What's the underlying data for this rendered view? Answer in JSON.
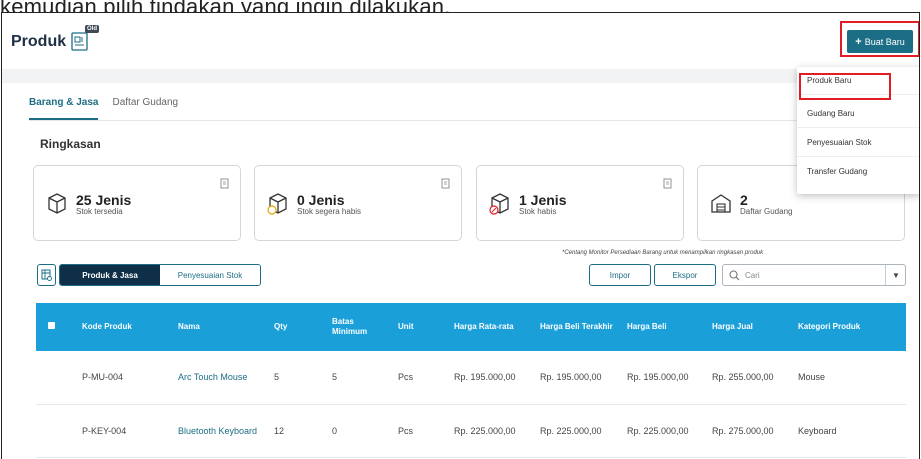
{
  "caption": "kemudian pilih tindakan yang ingin dilakukan.",
  "header": {
    "title": "Produk",
    "old_badge": "Old",
    "create_button": "Buat Baru"
  },
  "tabs": [
    {
      "label": "Barang & Jasa",
      "active": true
    },
    {
      "label": "Daftar Gudang",
      "active": false
    }
  ],
  "summary": {
    "title": "Ringkasan",
    "cards": [
      {
        "value": "25 Jenis",
        "label": "Stok tersedia",
        "icon": "box-icon"
      },
      {
        "value": "0 Jenis",
        "label": "Stok segera habis",
        "icon": "box-warning-icon"
      },
      {
        "value": "1 Jenis",
        "label": "Stok habis",
        "icon": "box-empty-icon"
      },
      {
        "value": "2",
        "label": "Daftar Gudang",
        "icon": "warehouse-icon"
      }
    ],
    "note": "*Centang Monitor Persediaan Barang untuk menampilkan ringkasan produk"
  },
  "toolbar": {
    "seg_products": "Produk & Jasa",
    "seg_adjust": "Penyesuaian Stok",
    "import": "Impor",
    "export": "Ekspor",
    "search_placeholder": "Cari"
  },
  "table": {
    "headers": [
      "Kode Produk",
      "Nama",
      "Qty",
      "Batas Minimum",
      "Unit",
      "Harga Rata-rata",
      "Harga Beli Terakhir",
      "Harga Beli",
      "Harga Jual",
      "Kategori Produk"
    ],
    "rows": [
      [
        "P-MU-004",
        "Arc Touch Mouse",
        "5",
        "5",
        "Pcs",
        "Rp. 195.000,00",
        "Rp. 195.000,00",
        "Rp. 195.000,00",
        "Rp. 255.000,00",
        "Mouse"
      ],
      [
        "P-KEY-004",
        "Bluetooth Keyboard",
        "12",
        "0",
        "Pcs",
        "Rp. 225.000,00",
        "Rp. 225.000,00",
        "Rp. 225.000,00",
        "Rp. 275.000,00",
        "Keyboard"
      ]
    ]
  },
  "dropdown": {
    "items": [
      "Produk Baru",
      "Gudang Baru",
      "Penyesuaian Stok",
      "Transfer Gudang"
    ]
  },
  "colors": {
    "primary": "#1c6e86",
    "table_header": "#1a9fd9",
    "dark_segment": "#0f2f49",
    "highlight": "#e21c23"
  }
}
